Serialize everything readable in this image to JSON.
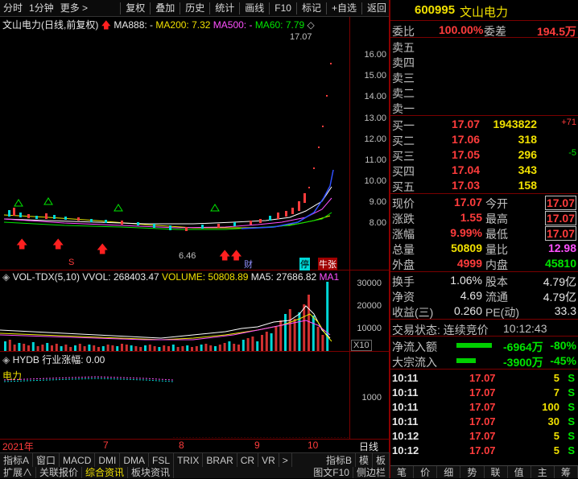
{
  "toolbar": {
    "left": [
      "分时",
      "1分钟",
      "更多 >"
    ],
    "right": [
      "复权",
      "叠加",
      "历史",
      "统计",
      "画线",
      "F10",
      "标记",
      "+自选",
      "返回"
    ]
  },
  "main_chart": {
    "title": "文山电力(日线,前复权)",
    "ma888": "MA888: -",
    "ma200": "MA200: 7.32",
    "ma500": "MA500: -",
    "ma60": "MA60: 7.79",
    "high_label": "17.07",
    "low_label": "6.46",
    "price_ticks": [
      "16.00",
      "15.00",
      "14.00",
      "13.00",
      "12.00",
      "11.00",
      "10.00",
      "9.00",
      "8.00"
    ],
    "markers": [
      "S",
      "财",
      "停",
      "牛张"
    ]
  },
  "vol_chart": {
    "title": "VOL-TDX(5,10)",
    "vvol": "VVOL: 268403.47",
    "volume": "VOLUME: 50808.89",
    "ma5": "MA5: 27686.82",
    "ma1": "MA1",
    "ticks": [
      "30000",
      "20000",
      "10000"
    ],
    "unit": "X10"
  },
  "ind_chart": {
    "title": "HYDB",
    "industry": "行业涨幅: 0.00",
    "power_label": "电力",
    "tick": "1000"
  },
  "xaxis": {
    "year": "2021年",
    "months": [
      "7",
      "8",
      "9",
      "10"
    ],
    "period": "日线"
  },
  "bottom_tabs_row1": [
    "指标A",
    "窗口",
    "MACD",
    "DMI",
    "DMA",
    "FSL",
    "TRIX",
    "BRAR",
    "CR",
    "VR",
    ">",
    "指标B",
    "模",
    "板"
  ],
  "bottom_tabs_row2": [
    "扩展∧",
    "关联报价",
    "综合资讯",
    "板块资讯"
  ],
  "bottom_right_tabs": [
    "图文F10",
    "侧边栏"
  ],
  "stock": {
    "code": "600995",
    "name": "文山电力"
  },
  "order_ratio": {
    "label1": "委比",
    "value1": "100.00%",
    "label2": "委差",
    "value2": "194.5万"
  },
  "asks": [
    {
      "label": "卖五"
    },
    {
      "label": "卖四"
    },
    {
      "label": "卖三"
    },
    {
      "label": "卖二"
    },
    {
      "label": "卖一"
    }
  ],
  "bids": [
    {
      "label": "买一",
      "price": "17.07",
      "vol": "1943822",
      "chg": "+71"
    },
    {
      "label": "买二",
      "price": "17.06",
      "vol": "318",
      "chg": ""
    },
    {
      "label": "买三",
      "price": "17.05",
      "vol": "296",
      "chg": "-5"
    },
    {
      "label": "买四",
      "price": "17.04",
      "vol": "343",
      "chg": ""
    },
    {
      "label": "买五",
      "price": "17.03",
      "vol": "158",
      "chg": ""
    }
  ],
  "quote": [
    {
      "l1": "现价",
      "v1": "17.07",
      "l2": "今开",
      "v2": "17.07"
    },
    {
      "l1": "涨跌",
      "v1": "1.55",
      "l2": "最高",
      "v2": "17.07"
    },
    {
      "l1": "涨幅",
      "v1": "9.99%",
      "l2": "最低",
      "v2": "17.07"
    },
    {
      "l1": "总量",
      "v1": "50809",
      "l2": "量比",
      "v2": "12.98"
    },
    {
      "l1": "外盘",
      "v1": "4999",
      "l2": "内盘",
      "v2": "45810"
    }
  ],
  "info": [
    {
      "l1": "换手",
      "v1": "1.06%",
      "l2": "股本",
      "v2": "4.79亿"
    },
    {
      "l1": "净资",
      "v1": "4.69",
      "l2": "流通",
      "v2": "4.79亿"
    },
    {
      "l1": "收益(三)",
      "v1": "0.260",
      "l2": "PE(动)",
      "v2": "33.3"
    }
  ],
  "trade_status": {
    "label": "交易状态: 连续竞价",
    "time": "10:12:43"
  },
  "flows": [
    {
      "label": "净流入额",
      "value": "-6964万",
      "pct": "-80%"
    },
    {
      "label": "大宗流入",
      "value": "-3900万",
      "pct": "-45%"
    }
  ],
  "ticks": [
    {
      "time": "10:11",
      "price": "17.07",
      "vol": "5",
      "dir": "S"
    },
    {
      "time": "10:11",
      "price": "17.07",
      "vol": "7",
      "dir": "S"
    },
    {
      "time": "10:11",
      "price": "17.07",
      "vol": "100",
      "dir": "S"
    },
    {
      "time": "10:11",
      "price": "17.07",
      "vol": "30",
      "dir": "S"
    },
    {
      "time": "10:12",
      "price": "17.07",
      "vol": "5",
      "dir": "S"
    },
    {
      "time": "10:12",
      "price": "17.07",
      "vol": "5",
      "dir": "S"
    }
  ],
  "side_tabs": [
    "笔",
    "价",
    "细",
    "势",
    "联",
    "值",
    "主",
    "筹"
  ]
}
